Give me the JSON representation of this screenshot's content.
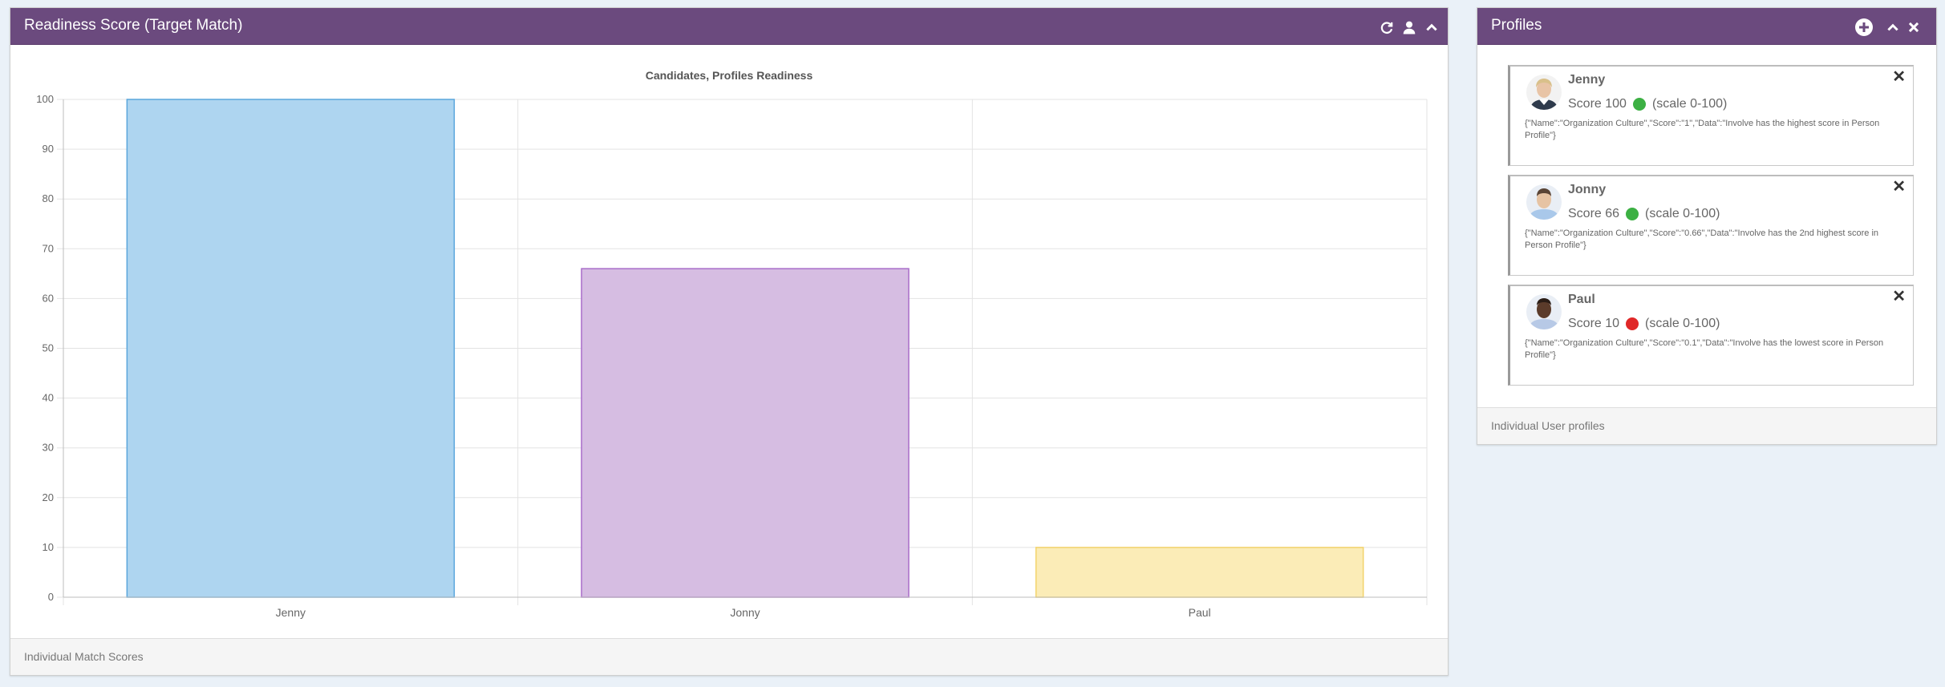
{
  "left_panel": {
    "title": "Readiness Score (Target Match)",
    "footer": "Individual Match Scores",
    "icons": [
      "refresh-icon",
      "user-icon",
      "chevron-up-icon"
    ]
  },
  "right_panel": {
    "title": "Profiles",
    "footer": "Individual User profiles",
    "icons": [
      "plus-circle-icon",
      "chevron-up-icon",
      "close-icon"
    ],
    "profiles": [
      {
        "name": "Jenny",
        "score_text": "Score 100",
        "status_color": "#3cb043",
        "scale_text": "(scale 0-100)",
        "data_text": "{\"Name\":\"Organization Culture\",\"Score\":\"1\",\"Data\":\"Involve has the highest score in Person Profile\"}",
        "close_label": "✕"
      },
      {
        "name": "Jonny",
        "score_text": "Score 66",
        "status_color": "#3cb043",
        "scale_text": "(scale 0-100)",
        "data_text": "{\"Name\":\"Organization Culture\",\"Score\":\"0.66\",\"Data\":\"Involve has the 2nd highest score in Person Profile\"}",
        "close_label": "✕"
      },
      {
        "name": "Paul",
        "score_text": "Score 10",
        "status_color": "#e02828",
        "scale_text": "(scale 0-100)",
        "data_text": "{\"Name\":\"Organization Culture\",\"Score\":\"0.1\",\"Data\":\"Involve has the lowest score in Person Profile\"}",
        "close_label": "✕"
      }
    ]
  },
  "colors": {
    "header": "#6b4a7e",
    "page_background": "#eaf1f8",
    "green_status": "#3cb043",
    "red_status": "#e02828"
  },
  "chart_data": {
    "type": "bar",
    "title": "Candidates, Profiles Readiness",
    "categories": [
      "Jenny",
      "Jonny",
      "Paul"
    ],
    "values": [
      100,
      66,
      10
    ],
    "bar_fill": [
      "#aed5f0",
      "#d6bde2",
      "#fbecb7"
    ],
    "bar_stroke": [
      "#5aa6dc",
      "#a86cc9",
      "#f2d36b"
    ],
    "ylim": [
      0,
      100
    ],
    "yticks": [
      0,
      10,
      20,
      30,
      40,
      50,
      60,
      70,
      80,
      90,
      100
    ],
    "xlabel": "",
    "ylabel": "",
    "grid": true,
    "legend": "none"
  }
}
